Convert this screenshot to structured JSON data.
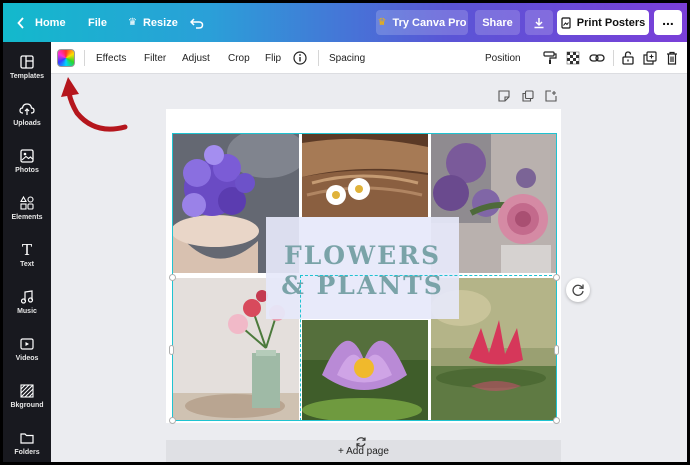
{
  "topbar": {
    "home_label": "Home",
    "file_label": "File",
    "resize_label": "Resize",
    "try_label": "Try Canva Pro",
    "share_label": "Share",
    "print_label": "Print Posters",
    "more_label": "..."
  },
  "toolbar": {
    "effects": "Effects",
    "filter": "Filter",
    "adjust": "Adjust",
    "crop": "Crop",
    "flip": "Flip",
    "spacing": "Spacing",
    "position": "Position"
  },
  "sidebar": {
    "items": [
      {
        "label": "Templates",
        "icon": "templates-icon"
      },
      {
        "label": "Uploads",
        "icon": "upload-icon"
      },
      {
        "label": "Photos",
        "icon": "photo-icon"
      },
      {
        "label": "Elements",
        "icon": "elements-icon"
      },
      {
        "label": "Text",
        "icon": "text-icon"
      },
      {
        "label": "Music",
        "icon": "music-icon"
      },
      {
        "label": "Videos",
        "icon": "video-icon"
      },
      {
        "label": "Bkground",
        "icon": "background-icon"
      },
      {
        "label": "Folders",
        "icon": "folder-icon"
      }
    ]
  },
  "design": {
    "title_line1": "FLOWERS",
    "title_line2": "& PLANTS",
    "title_color": "#7aa3a8"
  },
  "canvas": {
    "add_page_label": "+ Add page"
  },
  "colors": {
    "selection": "#1fc3d1",
    "sidebar_bg": "#18191f",
    "annotation_arrow": "#b5161d"
  }
}
